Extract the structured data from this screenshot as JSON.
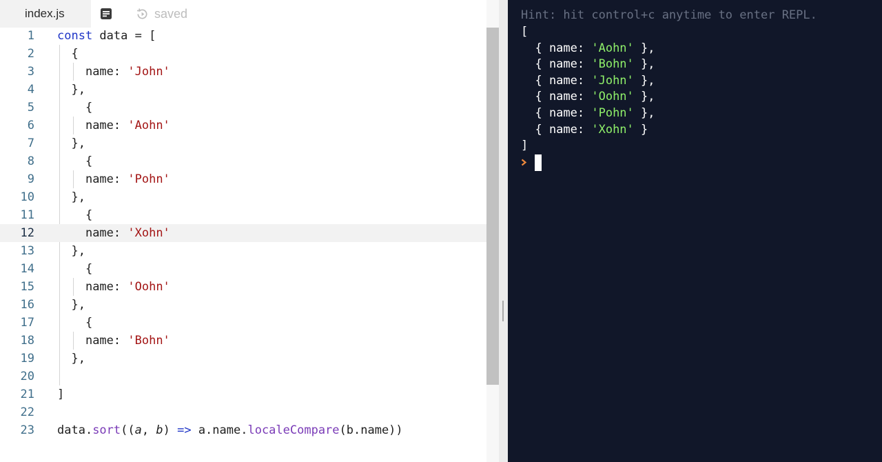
{
  "editor": {
    "tab_label": "index.js",
    "saved_label": "saved",
    "active_line": 12,
    "lines": [
      {
        "n": "1"
      },
      {
        "n": "2"
      },
      {
        "n": "3"
      },
      {
        "n": "4"
      },
      {
        "n": "5"
      },
      {
        "n": "6"
      },
      {
        "n": "7"
      },
      {
        "n": "8"
      },
      {
        "n": "9"
      },
      {
        "n": "10"
      },
      {
        "n": "11"
      },
      {
        "n": "12"
      },
      {
        "n": "13"
      },
      {
        "n": "14"
      },
      {
        "n": "15"
      },
      {
        "n": "16"
      },
      {
        "n": "17"
      },
      {
        "n": "18"
      },
      {
        "n": "19"
      },
      {
        "n": "20"
      },
      {
        "n": "21"
      },
      {
        "n": "22"
      },
      {
        "n": "23"
      }
    ],
    "code": {
      "l1_kw": "const",
      "l1_rest": " data = [",
      "open_brace": "{",
      "close_brace": "},",
      "prop": "name: ",
      "names": [
        "'John'",
        "'Aohn'",
        "'Pohn'",
        "'Xohn'",
        "'Oohn'",
        "'Bohn'"
      ],
      "l21": "]",
      "l23_a": "data.",
      "l23_sort": "sort",
      "l23_b": "((",
      "l23_pa": "a",
      "l23_c": ", ",
      "l23_pb": "b",
      "l23_d": ") ",
      "l23_arrow": "=>",
      "l23_e": " a.name.",
      "l23_lc": "localeCompare",
      "l23_f": "(b.name))"
    }
  },
  "console": {
    "hint": "Hint: hit control+c anytime to enter REPL.",
    "open": "[",
    "close": "]",
    "entry_prefix": "  { name: ",
    "entry_suffix_comma": " },",
    "entry_suffix_last": " }",
    "sorted_names": [
      "'Aohn'",
      "'Bohn'",
      "'John'",
      "'Oohn'",
      "'Pohn'",
      "'Xohn'"
    ]
  },
  "colors": {
    "console_bg": "#111729",
    "string_editor": "#a31515",
    "string_console": "#8ff06a",
    "keyword": "#1f35c7",
    "function": "#7a3bb7",
    "prompt": "#f08a3c"
  },
  "icons": {
    "format": "format-document-icon",
    "saved": "saved-history-icon",
    "prompt": "prompt-chevron-icon"
  }
}
